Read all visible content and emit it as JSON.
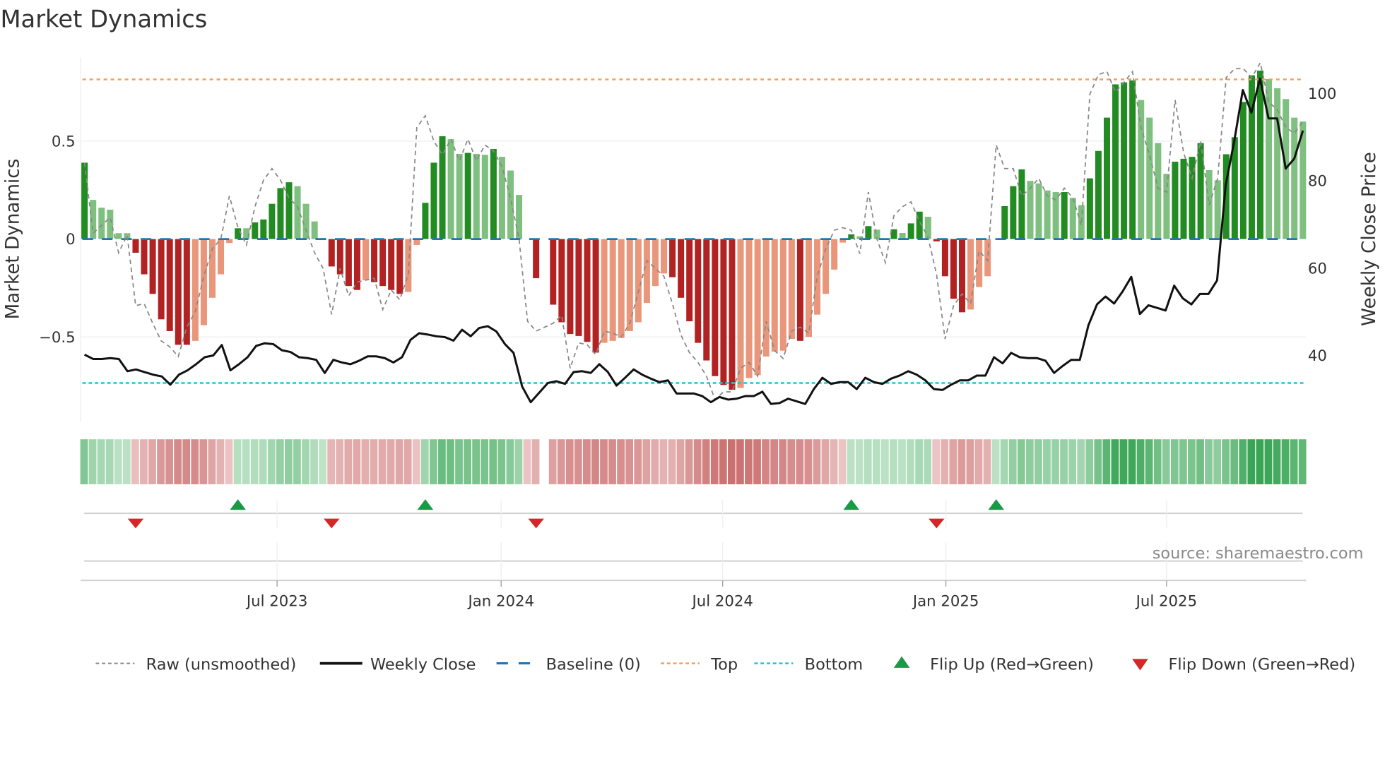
{
  "title": "Market Dynamics",
  "source": "source: sharemaestro.com",
  "chart_data": {
    "type": "bar",
    "title": "Market Dynamics",
    "ylabel": "Market Dynamics",
    "y2label": "Weekly Close Price",
    "ylim": [
      -0.93,
      0.93
    ],
    "y2lim": [
      24.8,
      108.3
    ],
    "yticks": [
      {
        "value": 0.5,
        "label": "0.5"
      },
      {
        "value": 0,
        "label": "0"
      },
      {
        "value": -0.5,
        "label": "−0.5"
      }
    ],
    "y2ticks": [
      {
        "value": 100,
        "label": "100"
      },
      {
        "value": 80,
        "label": "80"
      },
      {
        "value": 60,
        "label": "60"
      },
      {
        "value": 40,
        "label": "40"
      }
    ],
    "xticks": [
      {
        "index": 22.6,
        "label": "Jul 2023"
      },
      {
        "index": 48.9,
        "label": "Jan 2024"
      },
      {
        "index": 74.9,
        "label": "Jul 2024"
      },
      {
        "index": 101.1,
        "label": "Jan 2025"
      },
      {
        "index": 127.0,
        "label": "Jul 2025"
      }
    ],
    "top_level": 0.815,
    "bottom_level": -0.735,
    "baseline": 0,
    "smoothed": [
      0.39,
      0.2,
      0.16,
      0.15,
      0.03,
      0.03,
      -0.07,
      -0.18,
      -0.28,
      -0.41,
      -0.47,
      -0.54,
      -0.54,
      -0.52,
      -0.44,
      -0.3,
      -0.18,
      -0.02,
      0.055,
      0.055,
      0.085,
      0.1,
      0.18,
      0.26,
      0.29,
      0.27,
      0.18,
      0.09,
      0.005,
      -0.14,
      -0.18,
      -0.24,
      -0.26,
      -0.21,
      -0.22,
      -0.24,
      -0.26,
      -0.28,
      -0.27,
      -0.03,
      0.185,
      0.39,
      0.525,
      0.51,
      0.435,
      0.44,
      0.435,
      0.43,
      0.46,
      0.42,
      0.35,
      0.225,
      0,
      -0.2,
      0,
      -0.335,
      -0.425,
      -0.485,
      -0.495,
      -0.525,
      -0.58,
      -0.53,
      -0.52,
      -0.505,
      -0.47,
      -0.425,
      -0.326,
      -0.24,
      -0.176,
      -0.195,
      -0.3,
      -0.42,
      -0.53,
      -0.62,
      -0.7,
      -0.745,
      -0.77,
      -0.76,
      -0.71,
      -0.695,
      -0.6,
      -0.575,
      -0.57,
      -0.51,
      -0.52,
      -0.5,
      -0.386,
      -0.28,
      -0.156,
      -0.018,
      0.024,
      0.014,
      0.066,
      0.048,
      0,
      0.05,
      0.031,
      0.08,
      0.14,
      0.114,
      -0.012,
      -0.19,
      -0.305,
      -0.374,
      -0.36,
      -0.245,
      -0.19,
      0,
      0.168,
      0.27,
      0.356,
      0.297,
      0.284,
      0.248,
      0.24,
      0.24,
      0.21,
      0.173,
      0.31,
      0.45,
      0.62,
      0.79,
      0.8,
      0.81,
      0.71,
      0.62,
      0.49,
      0.333,
      0.395,
      0.41,
      0.42,
      0.49,
      0.352,
      0.3,
      0.433,
      0.52,
      0.7,
      0.836,
      0.86,
      0.817,
      0.77,
      0.715,
      0.62,
      0.6
    ],
    "bar_shade": "DLLLLLRRRRRRRSSSSSDLDDDDDLLLLRRRRSRRRRSSDDDLLDLLDLLL-R-RRRRRRSSSSSSSSRRRRRRRRSSSSSSSRSSSSSDLDL-DLDDLRRRRSSS-DDDLLLLDLLDDDDDDLLLLDDDDLLDDDDDLLLLL",
    "raw": [
      0.39,
      0.03,
      0.07,
      0.11,
      -0.07,
      0.02,
      -0.34,
      -0.33,
      -0.43,
      -0.52,
      -0.55,
      -0.6,
      -0.45,
      -0.37,
      -0.19,
      -0.05,
      0,
      0.22,
      0.06,
      -0.03,
      0.165,
      0.3,
      0.36,
      0.3,
      0.21,
      0.165,
      0.045,
      -0.07,
      -0.15,
      -0.385,
      -0.15,
      -0.29,
      -0.22,
      -0.21,
      -0.2,
      -0.36,
      -0.26,
      -0.31,
      -0.18,
      0.57,
      0.63,
      0.5,
      0.43,
      0.51,
      0.4,
      0.51,
      0.4,
      0.48,
      0.45,
      0.37,
      0.21,
      0,
      -0.42,
      -0.47,
      -0.45,
      -0.43,
      -0.39,
      -0.66,
      -0.53,
      -0.54,
      -0.59,
      -0.47,
      -0.48,
      -0.5,
      -0.43,
      -0.27,
      -0.11,
      -0.15,
      -0.19,
      -0.33,
      -0.49,
      -0.58,
      -0.63,
      -0.7,
      -0.82,
      -0.78,
      -0.78,
      -0.66,
      -0.63,
      -0.7,
      -0.42,
      -0.57,
      -0.61,
      -0.47,
      -0.45,
      -0.48,
      -0.19,
      -0.05,
      0.045,
      0.058,
      0.045,
      -0.075,
      0.24,
      0,
      -0.12,
      0.12,
      0.165,
      0.19,
      0.09,
      0.01,
      -0.18,
      -0.51,
      -0.34,
      -0.28,
      -0.33,
      -0.06,
      -0.11,
      0.48,
      0.36,
      0.36,
      0.22,
      0.26,
      0.31,
      0.22,
      0.2,
      0.26,
      0.21,
      0.07,
      0.74,
      0.84,
      0.855,
      0.75,
      0.8,
      0.855,
      0.57,
      0.43,
      0.26,
      0.24,
      0.71,
      0.44,
      0.31,
      0.5,
      0.175,
      0.31,
      0.825,
      0.87,
      0.87,
      0.825,
      0.9,
      0.7,
      0.66,
      0.57,
      0.54,
      0.6
    ],
    "weekly_close": [
      40.2,
      39.2,
      39.2,
      39.4,
      39.2,
      36.4,
      36.8,
      36.2,
      35.6,
      35.2,
      33.3,
      35.6,
      36.6,
      38.0,
      39.6,
      40.0,
      42.4,
      36.6,
      38.0,
      39.6,
      42.2,
      42.8,
      42.6,
      41.2,
      40.8,
      39.6,
      39.4,
      39.0,
      36.0,
      39.0,
      38.4,
      38.0,
      38.8,
      39.8,
      39.8,
      39.4,
      38.4,
      39.6,
      43.6,
      45.1,
      44.8,
      44.4,
      44.2,
      43.4,
      45.9,
      44.4,
      46.3,
      46.7,
      45.5,
      42.6,
      40.6,
      32.9,
      29.3,
      31.5,
      33.7,
      34.1,
      33.5,
      36.2,
      36.4,
      36.0,
      38.0,
      36.2,
      33.1,
      34.9,
      36.8,
      35.6,
      34.7,
      33.9,
      34.3,
      31.3,
      31.3,
      31.3,
      30.7,
      29.3,
      30.5,
      29.9,
      30.1,
      30.7,
      30.7,
      31.7,
      28.9,
      29.1,
      30.1,
      29.5,
      28.9,
      32.3,
      34.9,
      33.5,
      33.9,
      33.9,
      32.3,
      34.9,
      33.9,
      33.5,
      34.7,
      35.4,
      36.4,
      35.6,
      34.3,
      32.3,
      32.1,
      33.3,
      34.3,
      34.3,
      35.4,
      35.4,
      39.6,
      38.2,
      40.6,
      39.6,
      39.4,
      39.4,
      38.8,
      36.0,
      37.6,
      39.0,
      39.0,
      46.9,
      51.7,
      53.5,
      51.9,
      54.7,
      58.0,
      49.5,
      51.5,
      50.9,
      50.3,
      56.0,
      53.1,
      51.7,
      54.1,
      54.1,
      57.2,
      79.0,
      89.1,
      100.8,
      95.6,
      103.4,
      94.3,
      94.3,
      82.8,
      85.1,
      91.5
    ],
    "missing_strip": [
      55
    ],
    "flip_up": [
      19,
      41,
      91,
      108
    ],
    "flip_down": [
      7,
      30,
      54,
      101
    ],
    "legend": [
      {
        "key": "raw",
        "label": "Raw (unsmoothed)"
      },
      {
        "key": "close",
        "label": "Weekly Close"
      },
      {
        "key": "baseline",
        "label": "Baseline (0)"
      },
      {
        "key": "top",
        "label": "Top"
      },
      {
        "key": "bottom",
        "label": "Bottom"
      },
      {
        "key": "flipup",
        "label": "Flip Up (Red→Green)"
      },
      {
        "key": "flipdown",
        "label": "Flip Down (Green→Red)"
      }
    ],
    "legend_position": "bottom"
  },
  "colors": {
    "dark_green": "#228b22",
    "light_green": "#7fbf7f",
    "dark_red": "#b22222",
    "salmon": "#e9967a",
    "baseline": "#1f77b4",
    "top": "#f0a060",
    "bottom": "#22c3d6",
    "raw": "#888888",
    "close": "#111111",
    "flip_up": "#1a9a45",
    "flip_down": "#d62728"
  }
}
